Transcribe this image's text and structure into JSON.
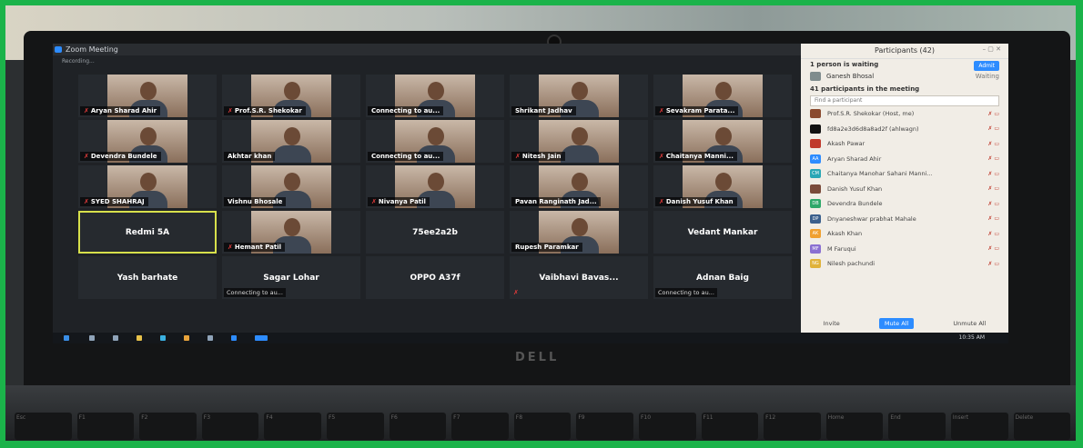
{
  "window": {
    "title": "Zoom Meeting",
    "recording": "Recording..."
  },
  "tiles": [
    {
      "name": "Aryan Sharad Ahir",
      "video": true,
      "muted": true
    },
    {
      "name": "Prof.S.R. Shekokar",
      "video": true,
      "muted": true
    },
    {
      "name": "Connecting to au...",
      "video": true,
      "muted": false
    },
    {
      "name": "Shrikant Jadhav",
      "video": true,
      "muted": false
    },
    {
      "name": "Sevakram Parata...",
      "video": true,
      "muted": true
    },
    {
      "name": "Devendra Bundele",
      "video": true,
      "muted": true
    },
    {
      "name": "Akhtar khan",
      "video": true,
      "muted": false
    },
    {
      "name": "Connecting to au...",
      "video": true,
      "muted": false
    },
    {
      "name": "Nitesh Jain",
      "video": true,
      "muted": true
    },
    {
      "name": "Chaitanya Manni...",
      "video": true,
      "muted": true
    },
    {
      "name": "SYED SHAHRAJ",
      "video": true,
      "muted": true
    },
    {
      "name": "Vishnu Bhosale",
      "video": true,
      "muted": false
    },
    {
      "name": "Nivanya Patil",
      "video": true,
      "muted": true
    },
    {
      "name": "Pavan Ranginath Jad...",
      "video": true,
      "muted": false
    },
    {
      "name": "Danish Yusuf Khan",
      "video": true,
      "muted": true
    },
    {
      "name": "Redmi 5A",
      "video": false,
      "muted": false,
      "highlight": true
    },
    {
      "name": "Hemant Patil",
      "video": true,
      "muted": true
    },
    {
      "name": "75ee2a2b",
      "video": false,
      "muted": false
    },
    {
      "name": "Rupesh Paramkar",
      "video": true,
      "muted": false
    },
    {
      "name": "Vedant Mankar",
      "video": false,
      "muted": false
    },
    {
      "name": "Yash barhate",
      "video": false,
      "muted": false
    },
    {
      "name": "Sagar Lohar",
      "video": false,
      "muted": false,
      "status": "Connecting to au..."
    },
    {
      "name": "OPPO A37f",
      "video": false,
      "muted": false
    },
    {
      "name": "Vaibhavi Bavas...",
      "video": false,
      "muted": true
    },
    {
      "name": "Adnan Baig",
      "video": false,
      "muted": false,
      "status": "Connecting to au..."
    }
  ],
  "participants_panel": {
    "title": "Participants (42)",
    "waiting_header": "1 person is waiting",
    "admit_label": "Admit",
    "waiting_person": "Ganesh Bhosal",
    "waiting_action": "Waiting",
    "in_meeting_header": "41 participants in the meeting",
    "find_placeholder": "Find a participant",
    "list": [
      {
        "name": "Prof.S.R. Shekokar (Host, me)",
        "initials": "",
        "color": "#8a4a2e"
      },
      {
        "name": "fd8a2e3d6d8a8ad2f (ahlwagn)",
        "initials": "",
        "color": "#111111"
      },
      {
        "name": "Akash Pawar",
        "initials": "",
        "color": "#c0392b"
      },
      {
        "name": "Aryan Sharad Ahir",
        "initials": "AA",
        "color": "#2d8cff"
      },
      {
        "name": "Chaitanya Manohar Sahani Manni...",
        "initials": "CM",
        "color": "#29a6b5"
      },
      {
        "name": "Danish Yusuf Khan",
        "initials": "",
        "color": "#7a4a3a"
      },
      {
        "name": "Devendra Bundele",
        "initials": "DB",
        "color": "#2ea86a"
      },
      {
        "name": "Dnyaneshwar prabhat Mahale",
        "initials": "DP",
        "color": "#3b5f8c"
      },
      {
        "name": "Akash Khan",
        "initials": "AK",
        "color": "#f0a030"
      },
      {
        "name": "M Faruqui",
        "initials": "MF",
        "color": "#8a6fd1"
      },
      {
        "name": "Nilesh pachundi",
        "initials": "NG",
        "color": "#e0b23a"
      }
    ],
    "buttons": [
      "Invite",
      "Mute All",
      "Unmute All"
    ]
  },
  "taskbar": {
    "time": "10:35 AM"
  },
  "laptop": {
    "brand": "DELL"
  },
  "keyboard": [
    "Esc",
    "F1",
    "F2",
    "F3",
    "F4",
    "F5",
    "F6",
    "F7",
    "F8",
    "F9",
    "F10",
    "F11",
    "F12",
    "Home",
    "End",
    "Insert",
    "Delete"
  ]
}
